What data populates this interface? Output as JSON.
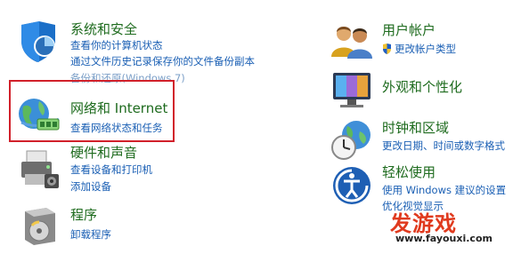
{
  "left": {
    "system": {
      "title": "系统和安全",
      "links": [
        "查看你的计算机状态",
        "通过文件历史记录保存你的文件备份副本",
        "备份和还原(Windows 7)"
      ]
    },
    "network": {
      "title": "网络和 Internet",
      "links": [
        "查看网络状态和任务"
      ]
    },
    "hardware": {
      "title": "硬件和声音",
      "links": [
        "查看设备和打印机",
        "添加设备"
      ]
    },
    "programs": {
      "title": "程序",
      "links": [
        "卸载程序"
      ]
    }
  },
  "right": {
    "accounts": {
      "title": "用户帐户",
      "links": [
        "更改帐户类型"
      ]
    },
    "appearance": {
      "title": "外观和个性化"
    },
    "clock": {
      "title": "时钟和区域",
      "links": [
        "更改日期、时间或数字格式"
      ]
    },
    "ease": {
      "title": "轻松使用",
      "links": [
        "使用 Windows 建议的设置",
        "优化视觉显示"
      ]
    }
  },
  "watermark": {
    "main": "发游戏",
    "url": "www.fayouxi.com"
  },
  "colors": {
    "title_green": "#1e6b1e",
    "link_blue": "#1a5fb4",
    "highlight_red": "#d1202a"
  }
}
